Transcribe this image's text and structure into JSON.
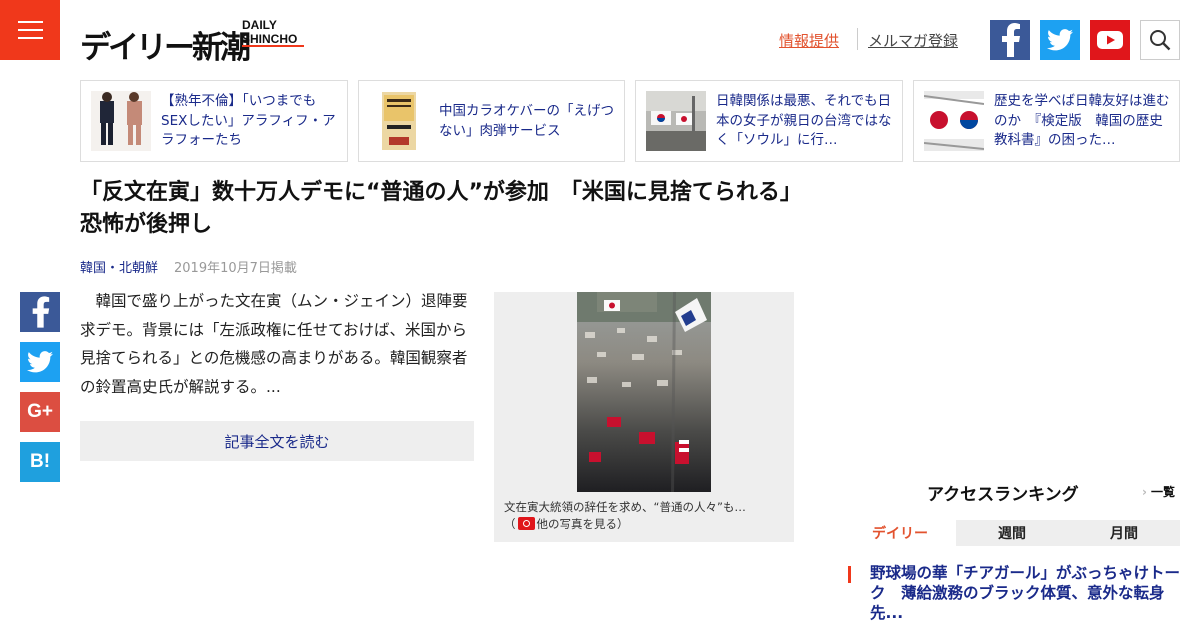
{
  "brand": {
    "logo_jp": "デイリー新潮",
    "logo_en_line1": "DAILY",
    "logo_en_line2": "SHINCHO",
    "accent": "#f0381b"
  },
  "header": {
    "menu_icon": "hamburger-icon",
    "info_link": "情報提供",
    "newsletter_link": "メルマガ登録",
    "social": [
      "facebook-icon",
      "twitter-icon",
      "youtube-icon"
    ],
    "search_icon": "search-icon"
  },
  "cards": [
    {
      "text": "【熟年不倫】「いつまでもSEXしたい」アラフィフ・アラフォーたち"
    },
    {
      "text": "中国カラオケバーの「えげつない」肉弾サービス"
    },
    {
      "text": "日韓関係は最悪、それでも日本の女子が親日の台湾ではなく「ソウル」に行…"
    },
    {
      "text": "歴史を学べば日韓友好は進むのか　『検定版　韓国の歴史教科書』の困った…"
    }
  ],
  "article": {
    "headline": "「反文在寅」数十万人デモに“普通の人”が参加　「米国に見捨てられる」恐怖が後押し",
    "category": "韓国・北朝鮮",
    "date": "2019年10月7日掲載",
    "lead": "韓国で盛り上がった文在寅（ムン・ジェイン）退陣要求デモ。背景には「左派政権に任せておけば、米国から見捨てられる」との危機感の高まりがある。韓国観察者の鈴置高史氏が解説する。...",
    "read_more": "記事全文を読む",
    "photo_caption": "文在寅大統領の辞任を求め、“普通の人々”も…",
    "photo_more_prefix": "（",
    "photo_more": "他の写真を見る）"
  },
  "share": {
    "icons": [
      "facebook-share-icon",
      "twitter-share-icon",
      "googleplus-share-icon",
      "hatena-bookmark-icon"
    ],
    "gplus_label": "G+",
    "hatena_label": "B!"
  },
  "ranking": {
    "title": "アクセスランキング",
    "more": "一覧",
    "tabs": [
      "デイリー",
      "週間",
      "月間"
    ],
    "active_tab": "デイリー",
    "items": [
      {
        "text": "野球場の華「チアガール」がぶっちゃけトーク　薄給激務のブラック体質、意外な転身先..."
      }
    ]
  },
  "colors": {
    "link_blue": "#1a2a8a",
    "facebook": "#3b5998",
    "twitter": "#1da1f2",
    "youtube": "#e0161b",
    "gplus": "#dc4e41",
    "hatena": "#1fa0de"
  }
}
